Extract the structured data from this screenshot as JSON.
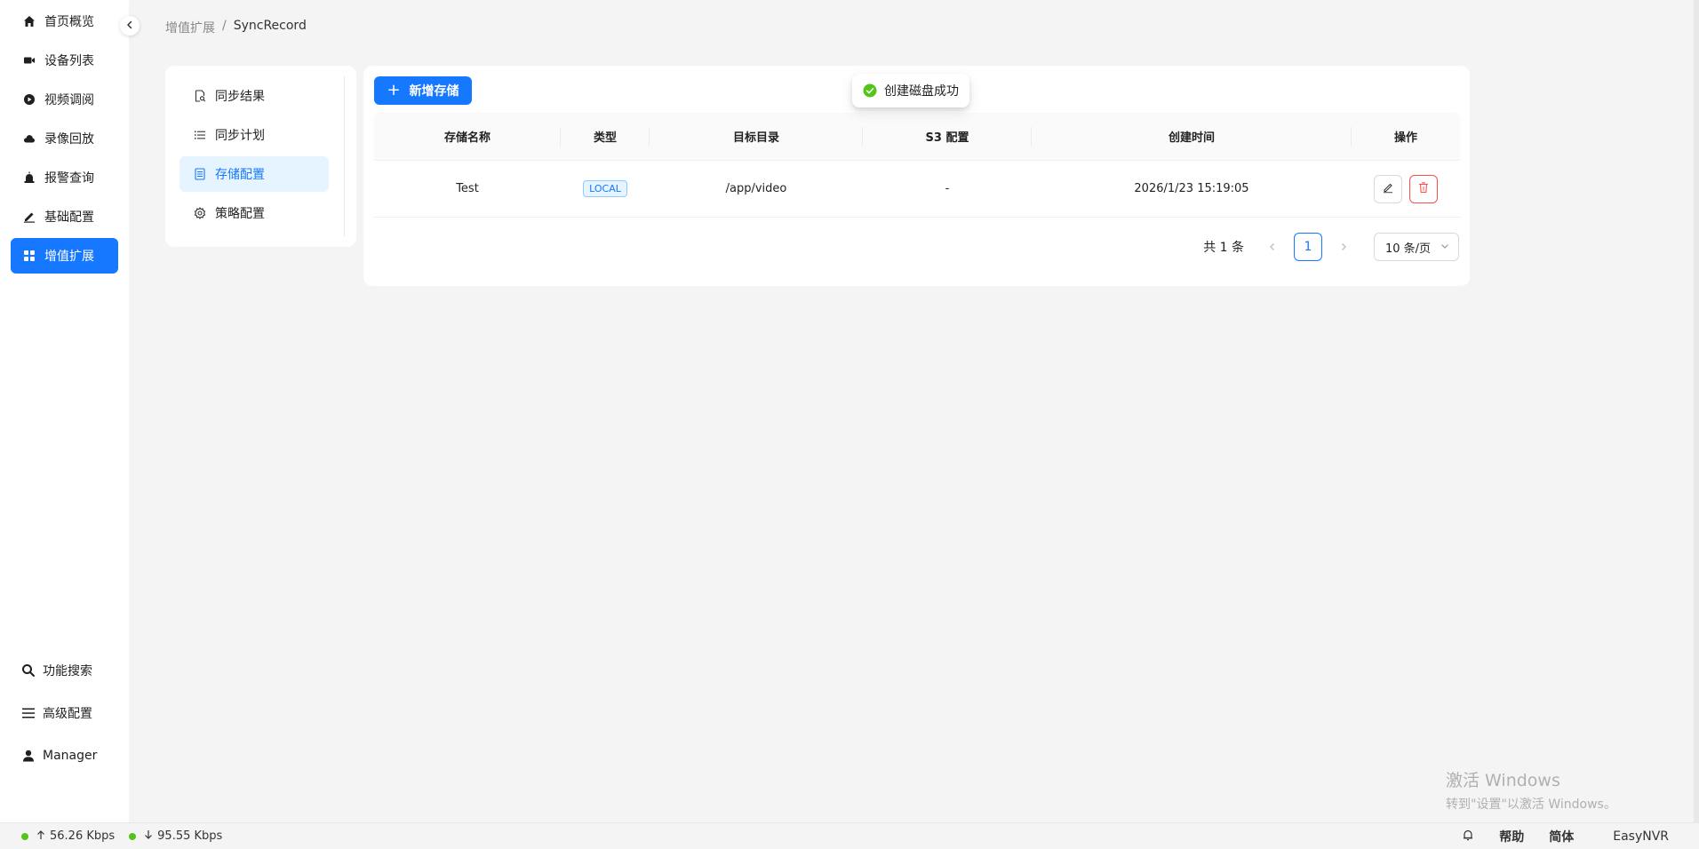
{
  "sidebar": {
    "items": [
      {
        "label": "首页概览",
        "icon": "home-icon"
      },
      {
        "label": "设备列表",
        "icon": "camera-icon"
      },
      {
        "label": "视频调阅",
        "icon": "play-circle-icon"
      },
      {
        "label": "录像回放",
        "icon": "cloud-icon"
      },
      {
        "label": "报警查询",
        "icon": "alarm-icon"
      },
      {
        "label": "基础配置",
        "icon": "edit-icon"
      },
      {
        "label": "增值扩展",
        "icon": "apps-icon"
      }
    ],
    "active_index": 6,
    "bottom": [
      {
        "label": "功能搜索",
        "icon": "search-icon"
      },
      {
        "label": "高级配置",
        "icon": "menu-icon"
      },
      {
        "label": "Manager",
        "icon": "user-icon"
      }
    ]
  },
  "breadcrumb": {
    "parent": "增值扩展",
    "separator": "/",
    "current": "SyncRecord"
  },
  "submenu": {
    "items": [
      {
        "label": "同步结果",
        "icon": "file-search-icon"
      },
      {
        "label": "同步计划",
        "icon": "list-icon"
      },
      {
        "label": "存储配置",
        "icon": "storage-icon"
      },
      {
        "label": "策略配置",
        "icon": "settings-icon"
      }
    ],
    "active_index": 2
  },
  "main": {
    "add_button": "新增存储",
    "table": {
      "columns": [
        "存储名称",
        "类型",
        "目标目录",
        "S3 配置",
        "创建时间",
        "操作"
      ],
      "rows": [
        {
          "name": "Test",
          "type": "LOCAL",
          "dir": "/app/video",
          "s3": "-",
          "created": "2026/1/23 15:19:05"
        }
      ]
    },
    "pagination": {
      "total": "共 1 条",
      "current_page": "1",
      "page_size": "10 条/页"
    }
  },
  "toast": {
    "message": "创建磁盘成功",
    "icon": "check-circle-icon"
  },
  "watermark": {
    "line1": "激活 Windows",
    "line2": "转到\"设置\"以激活 Windows。"
  },
  "statusbar": {
    "upload": "56.26 Kbps",
    "download": "95.55 Kbps",
    "help": "帮助",
    "language": "简体",
    "brand": "EasyNVR"
  },
  "colors": {
    "primary": "#1677ff",
    "success": "#52c41a",
    "danger": "#ff4d4f"
  }
}
